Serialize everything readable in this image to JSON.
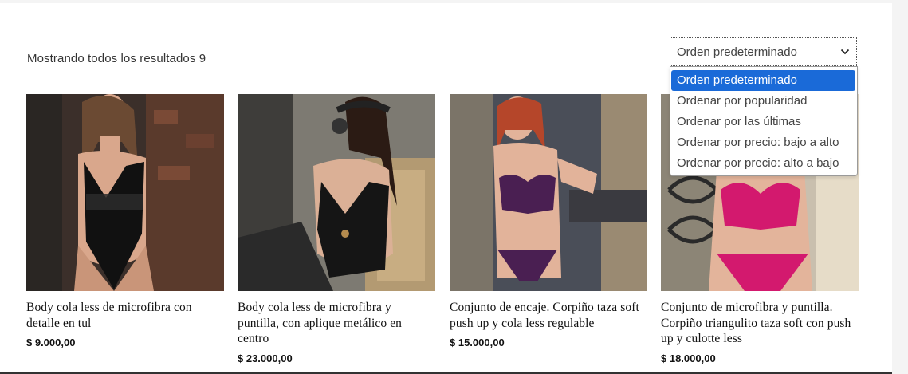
{
  "shop": {
    "result_count": "Mostrando todos los resultados 9",
    "orderby": {
      "selected": "Orden predeterminado",
      "options": [
        "Orden predeterminado",
        "Ordenar por popularidad",
        "Ordenar por las últimas",
        "Ordenar por precio: bajo a alto",
        "Ordenar por precio: alto a bajo"
      ]
    }
  },
  "products": [
    {
      "title": "Body cola less de microfibra con detalle en tul",
      "price": "$ 9.000,00"
    },
    {
      "title": "Body cola less de microfibra y puntilla, con aplique metálico en centro",
      "price": "$ 23.000,00"
    },
    {
      "title": "Conjunto de encaje. Corpiño taza soft push up y cola less regulable",
      "price": "$ 15.000,00"
    },
    {
      "title": "Conjunto de microfibra y puntilla. Corpiño triangulito taza soft con push up y culotte less",
      "price": "$ 18.000,00"
    }
  ],
  "colors": {
    "accent_option": "#1a6ad8",
    "product_1_garment": "#111111",
    "product_2_garment": "#151515",
    "product_3_garment": "#4a1f52",
    "product_4_garment": "#d3196e"
  }
}
